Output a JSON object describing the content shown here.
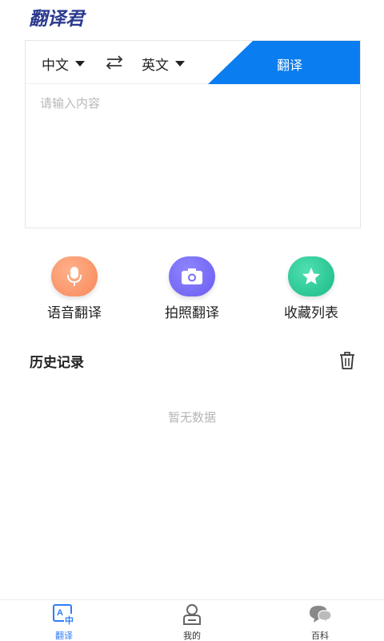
{
  "app": {
    "logo_text": "翻译君"
  },
  "translator": {
    "from_lang": "中文",
    "to_lang": "英文",
    "translate_label": "翻译",
    "input_placeholder": "请输入内容",
    "input_value": ""
  },
  "features": {
    "voice_label": "语音翻译",
    "photo_label": "拍照翻译",
    "favorites_label": "收藏列表"
  },
  "history": {
    "title": "历史记录",
    "empty_text": "暂无数据"
  },
  "tabbar": {
    "translate_label": "翻译",
    "mine_label": "我的",
    "wiki_label": "百科"
  },
  "colors": {
    "accent_blue": "#0a7df0",
    "logo_navy": "#2b3a8f",
    "voice_orange": "#f7895a",
    "photo_purple": "#6a5bf0",
    "favorites_green": "#1cb988"
  }
}
